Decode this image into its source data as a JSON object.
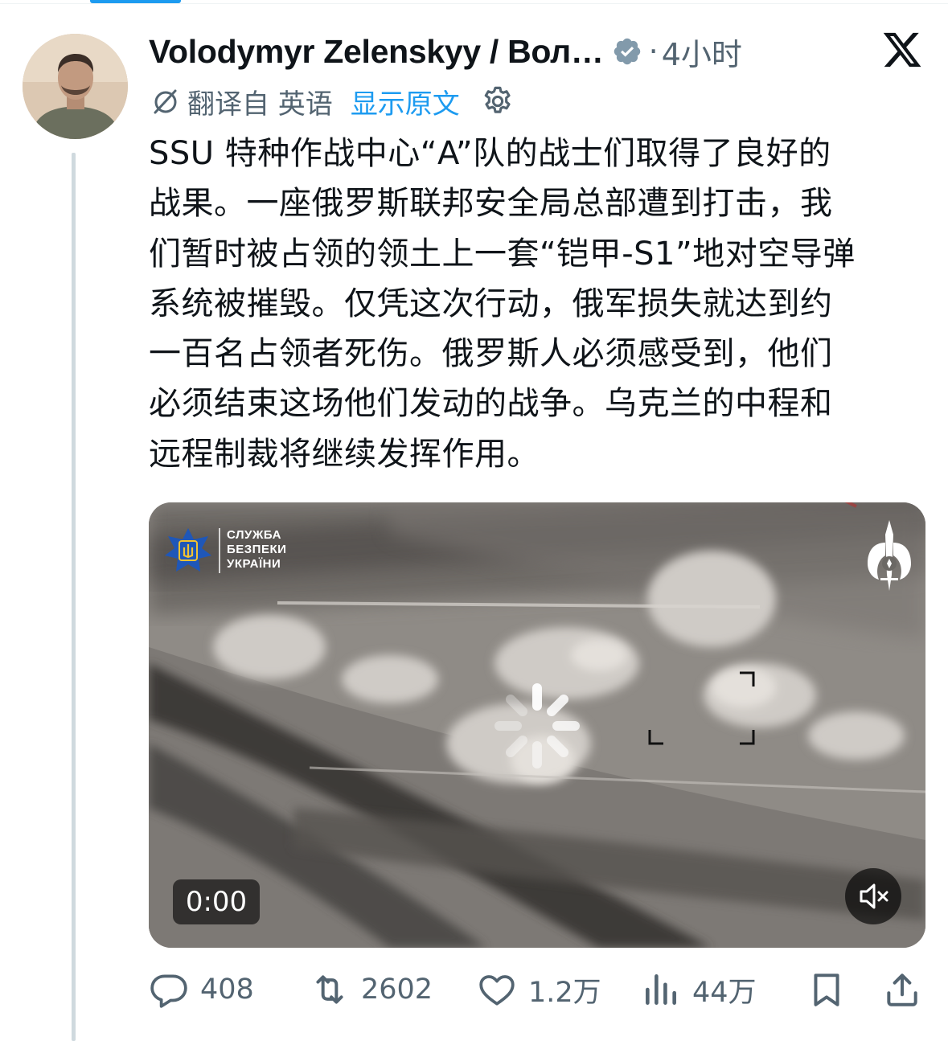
{
  "tweet": {
    "author": "Volodymyr Zelenskyy / Вол…",
    "dot": "·",
    "time": "4小时",
    "translated_from": "翻译自 英语",
    "show_original": "显示原文",
    "text": "SSU 特种作战中心“A”队的战士们取得了良好的\n战果。一座俄罗斯联邦安全局总部遭到打击，我\n们暂时被占领的领土上一套“铠甲-S1”地对空导弹\n系统被摧毁。仅凭这次行动，俄军损失就达到约\n一百名占领者死伤。俄罗斯人必须感受到，他们\n必须结束这场他们发动的战争。乌克兰的中程和\n远程制裁将继续发挥作用。"
  },
  "video": {
    "ssu_logo_lines": [
      "СЛУЖБА",
      "БЕЗПЕКИ",
      "УКРАЇНИ"
    ],
    "current_time": "0:00",
    "muted": true
  },
  "actions": {
    "replies": "408",
    "reposts": "2602",
    "likes": "1.2万",
    "views": "44万"
  },
  "colors": {
    "accent": "#1d9bf0",
    "secondary_text": "#536471",
    "verified_badge": "#829aab",
    "thread_line": "#cfd9de"
  },
  "icons": [
    "verified-icon",
    "x-logo-icon",
    "translate-icon",
    "gear-icon",
    "loading-spinner-icon",
    "mute-icon",
    "reply-icon",
    "repost-icon",
    "like-icon",
    "views-icon",
    "bookmark-icon",
    "share-icon"
  ]
}
